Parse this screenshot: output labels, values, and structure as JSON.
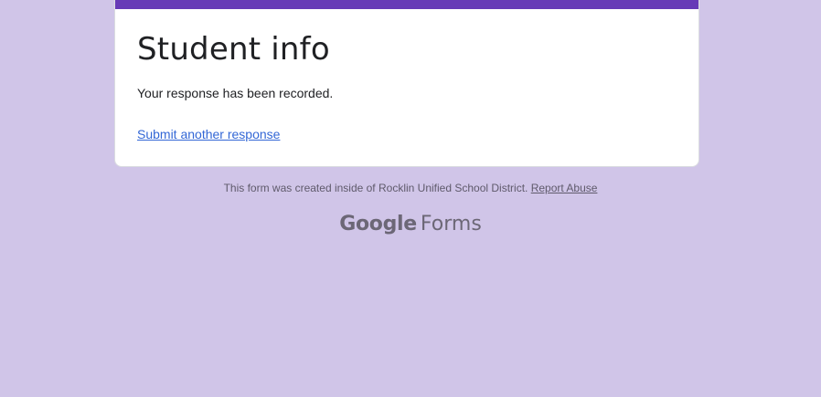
{
  "card": {
    "title": "Student info",
    "message": "Your response has been recorded.",
    "link_label": "Submit another response"
  },
  "footer": {
    "note": "This form was created inside of Rocklin Unified School District.",
    "report_label": "Report Abuse"
  },
  "brand": {
    "google": "Google",
    "product": "Forms"
  },
  "colors": {
    "accent": "#673ab7",
    "background": "#d0c5e8",
    "link": "#3367d6"
  }
}
